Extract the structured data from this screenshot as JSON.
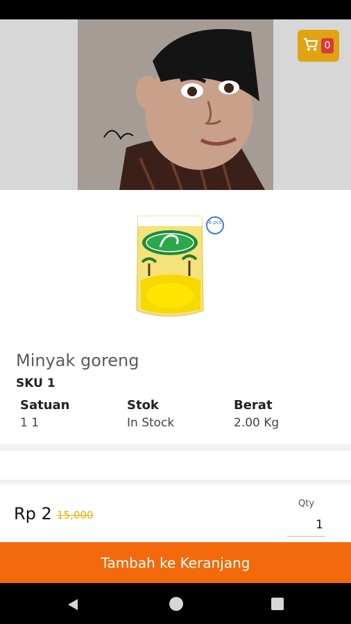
{
  "cart": {
    "count": "0",
    "icon": "cart-icon",
    "color": "#e0a412",
    "badge_color": "#d83a3a"
  },
  "product": {
    "image_icon": "oil-pouch-image",
    "pcs_badge": "6 pcs",
    "title": "Minyak goreng",
    "sku": "SKU 1",
    "specs": [
      {
        "label": "Satuan",
        "value": "1 1"
      },
      {
        "label": "Stok",
        "value": "In Stock"
      },
      {
        "label": "Berat",
        "value": "2.00 Kg"
      }
    ]
  },
  "pricing": {
    "price": "Rp 2",
    "old_price": "15,000",
    "old_price_color": "#e8b200"
  },
  "quantity": {
    "label": "Qty",
    "value": "1"
  },
  "actions": {
    "add_to_cart": "Tambah ke Keranjang",
    "button_color": "#f26a0c"
  },
  "nav": {
    "back_icon": "back-triangle-icon",
    "home_icon": "home-circle-icon",
    "recents_icon": "recents-square-icon"
  }
}
